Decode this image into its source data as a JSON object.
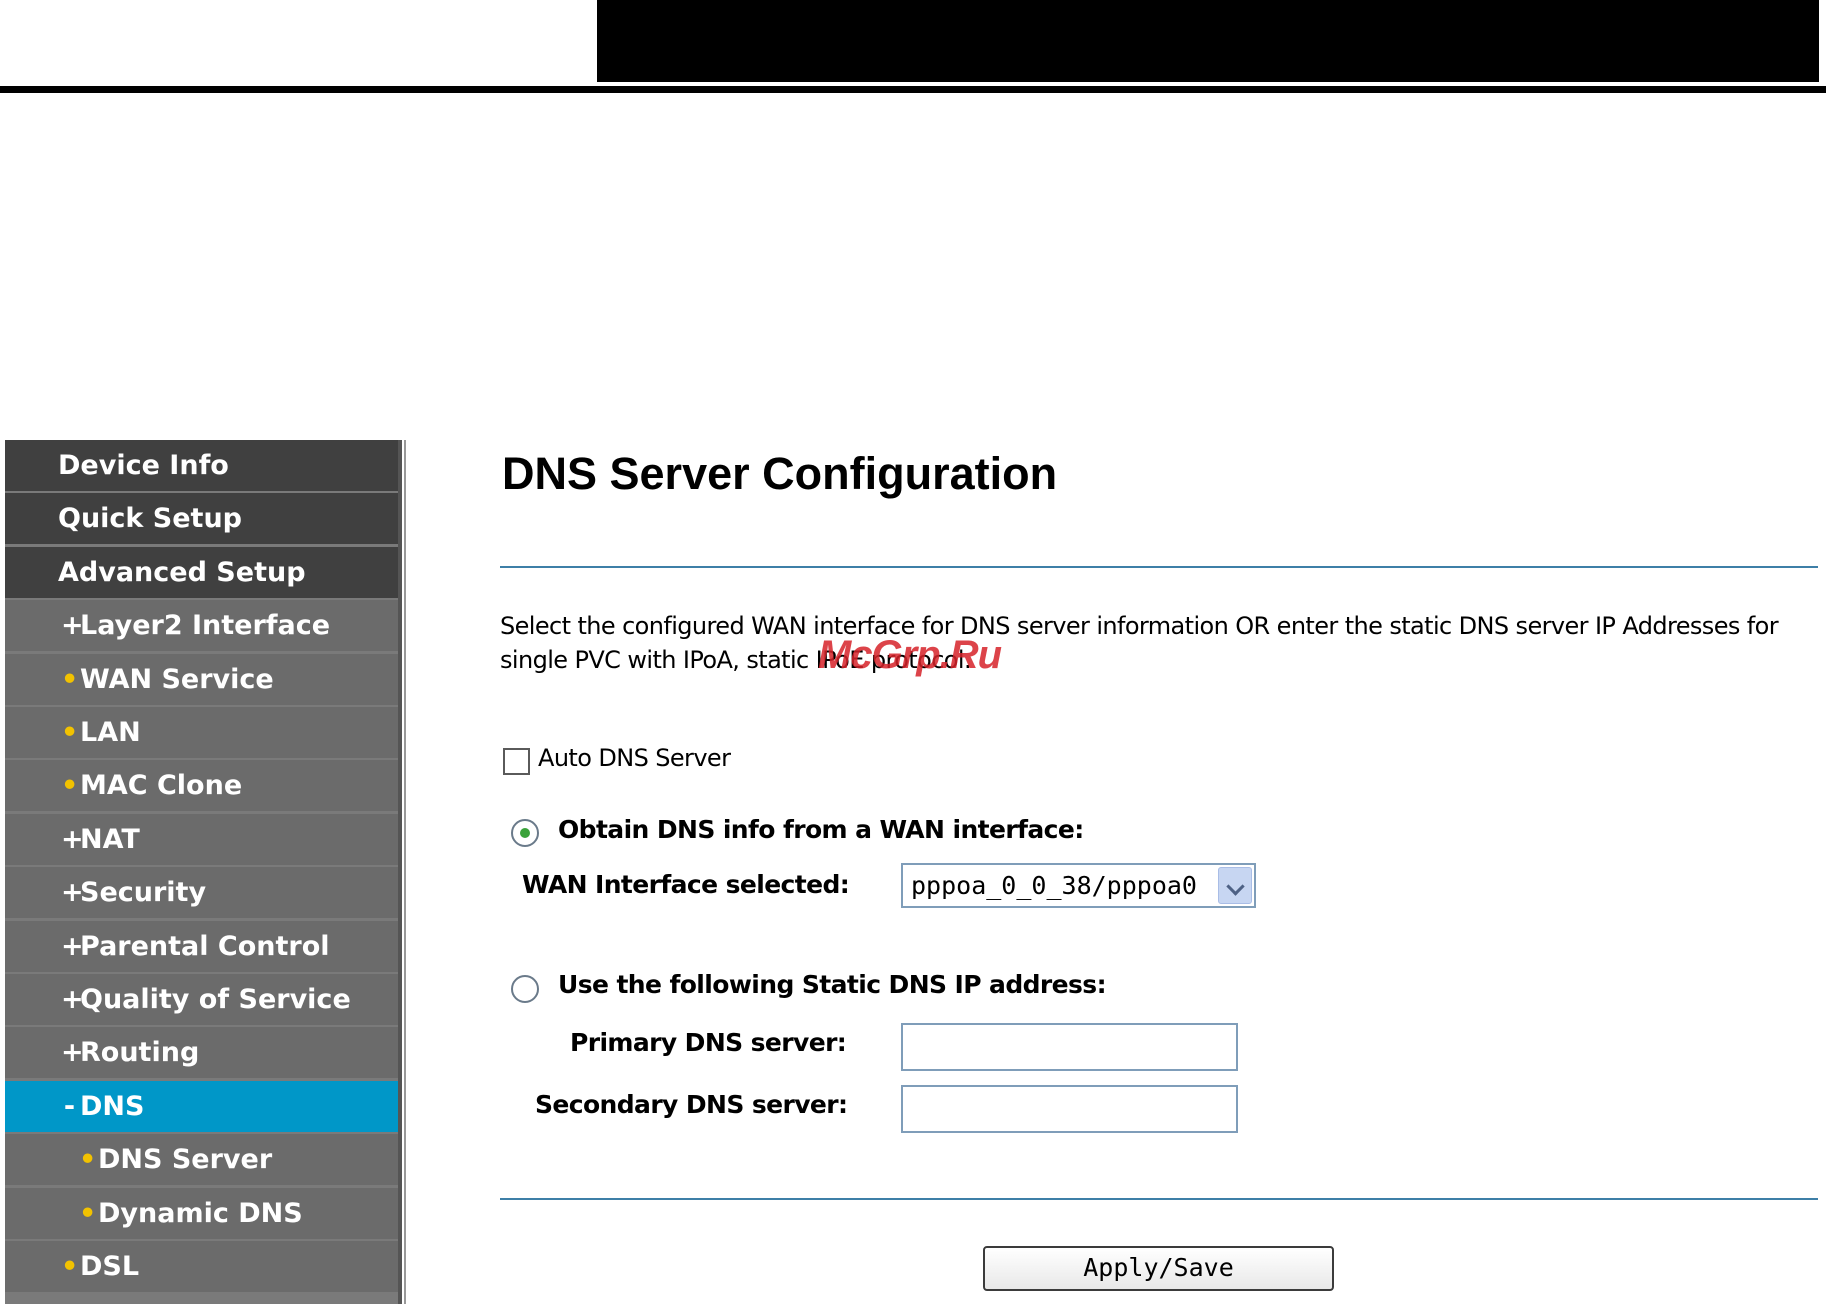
{
  "sidebar": {
    "items": [
      {
        "label": "Device Info",
        "prefix": "",
        "level": "top"
      },
      {
        "label": "Quick Setup",
        "prefix": "",
        "level": "top"
      },
      {
        "label": "Advanced Setup",
        "prefix": "",
        "level": "top"
      },
      {
        "label": "Layer2 Interface",
        "prefix": "+",
        "level": "sub"
      },
      {
        "label": "WAN Service",
        "prefix": "•",
        "level": "sub"
      },
      {
        "label": "LAN",
        "prefix": "•",
        "level": "sub"
      },
      {
        "label": "MAC Clone",
        "prefix": "•",
        "level": "sub"
      },
      {
        "label": "NAT",
        "prefix": "+",
        "level": "sub"
      },
      {
        "label": "Security",
        "prefix": "+",
        "level": "sub"
      },
      {
        "label": "Parental Control",
        "prefix": "+",
        "level": "sub"
      },
      {
        "label": "Quality of Service",
        "prefix": "+",
        "level": "sub"
      },
      {
        "label": "Routing",
        "prefix": "+",
        "level": "sub"
      },
      {
        "label": "DNS",
        "prefix": "-",
        "level": "sub-active"
      },
      {
        "label": "DNS Server",
        "prefix": "•",
        "level": "subsub"
      },
      {
        "label": "Dynamic DNS",
        "prefix": "•",
        "level": "subsub"
      },
      {
        "label": "DSL",
        "prefix": "•",
        "level": "sub"
      }
    ],
    "active_color": "#0097c8"
  },
  "main": {
    "title": "DNS Server Configuration",
    "description": "Select the configured WAN interface for DNS server information OR enter the static DNS server IP Addresses for single PVC with IPoA, static IPoE protocol.",
    "watermark": "McGrp.Ru",
    "auto_dns_label": "Auto DNS Server",
    "auto_dns_checked": false,
    "option_wan_label": "Obtain DNS info from a WAN interface:",
    "option_wan_selected": true,
    "wan_interface_label": "WAN Interface selected:",
    "wan_interface_value": "pppoa_0_0_38/pppoa0",
    "option_static_label": "Use the following Static DNS IP address:",
    "option_static_selected": false,
    "primary_dns_label": "Primary DNS server:",
    "primary_dns_value": "",
    "secondary_dns_label": "Secondary DNS server:",
    "secondary_dns_value": "",
    "apply_label": "Apply/Save"
  }
}
